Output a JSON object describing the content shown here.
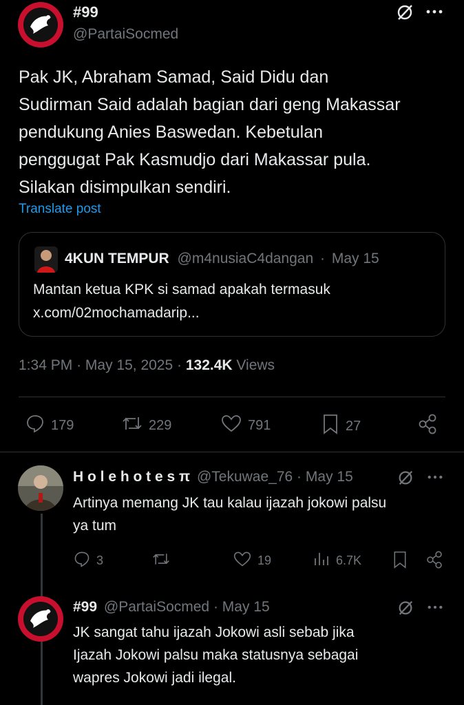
{
  "main_post": {
    "display_name": "#99",
    "handle": "@PartaiSocmed",
    "text_lines": [
      "Pak JK, Abraham Samad, Said Didu dan",
      "Sudirman Said adalah bagian dari geng Makassar",
      "pendukung Anies Baswedan. Kebetulan",
      "penggugat Pak Kasmudjo dari Makassar pula.",
      "Silakan disimpulkan sendiri."
    ],
    "translate_label": "Translate post",
    "quote": {
      "display_name": "4KUN TEMPUR",
      "handle": "@m4nusiaC4dangan",
      "dot": "·",
      "date": "May 15",
      "text_lines": [
        "Mantan ketua KPK si samad apakah termasuk",
        "x.com/02mochamadarip..."
      ]
    },
    "meta": {
      "time": "1:34 PM",
      "dot1": "·",
      "date": "May 15, 2025",
      "dot2": "·",
      "views_count": "132.4K",
      "views_label": "Views"
    },
    "actions": {
      "replies": "179",
      "reposts": "229",
      "likes": "791",
      "bookmarks": "27"
    }
  },
  "replies": [
    {
      "display_name": "H o l e h o t e s π",
      "handle": "@Tekuwae_76",
      "dot": "·",
      "date": "May 15",
      "text_lines": [
        "Artinya memang JK tau kalau ijazah jokowi palsu",
        "ya tum"
      ],
      "actions": {
        "replies": "3",
        "reposts": "",
        "likes": "19",
        "views": "6.7K"
      }
    },
    {
      "display_name": "#99",
      "handle": "@PartaiSocmed",
      "dot": "·",
      "date": "May 15",
      "text_lines": [
        "JK sangat tahu ijazah Jokowi asli sebab jika",
        "Ijazah Jokowi palsu maka statusnya sebagai",
        "wapres Jokowi jadi ilegal."
      ]
    }
  ],
  "colors": {
    "background": "#000000",
    "text": "#e7e9ea",
    "muted": "#71767b",
    "link": "#1d9bf0",
    "border": "#2f3336",
    "avatar_red": "#c8102e"
  },
  "icons": [
    "grok-icon",
    "more-icon",
    "reply-icon",
    "repost-icon",
    "like-icon",
    "bookmark-icon",
    "share-icon",
    "views-icon"
  ]
}
